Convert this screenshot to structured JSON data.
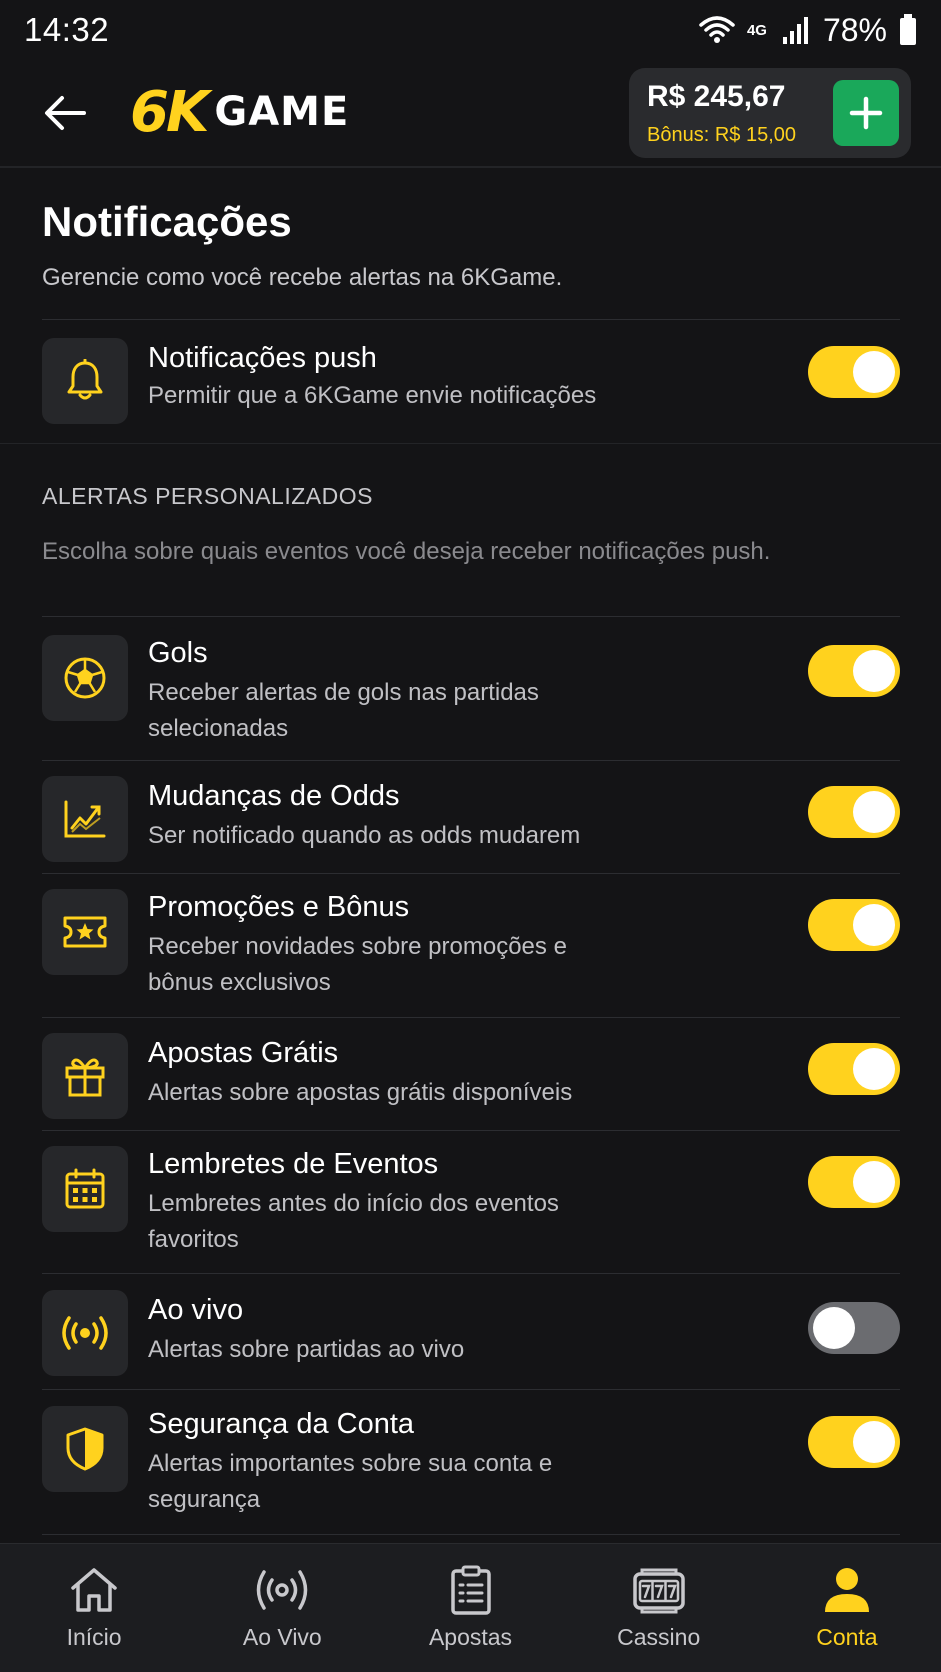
{
  "status_bar": {
    "time": "14:32",
    "network": "4G",
    "battery": "78%"
  },
  "header": {
    "logo_left": "6K",
    "logo_right": "GAME",
    "balance": "R$ 245,67",
    "bonus": "Bônus: R$ 15,00"
  },
  "page": {
    "title": "Notificações",
    "subtitle": "Gerencie como você recebe alertas na 6KGame."
  },
  "push": {
    "title": "Notificações push",
    "desc": "Permitir que a 6KGame envie notificações",
    "enabled": true,
    "icon": "bell-icon"
  },
  "section": {
    "heading": "ALERTAS PERSONALIZADOS",
    "desc": "Escolha sobre quais eventos você deseja receber notificações push."
  },
  "alerts": [
    {
      "title": "Gols",
      "desc": "Receber alertas de gols nas partidas selecionadas",
      "enabled": true,
      "icon": "soccer-ball-icon"
    },
    {
      "title": "Mudanças de Odds",
      "desc": "Ser notificado quando as odds mudarem",
      "enabled": true,
      "icon": "chart-trend-icon"
    },
    {
      "title": "Promoções e Bônus",
      "desc": "Receber novidades sobre promoções e bônus exclusivos",
      "enabled": true,
      "icon": "ticket-star-icon"
    },
    {
      "title": "Apostas Grátis",
      "desc": "Alertas sobre apostas grátis disponíveis",
      "enabled": true,
      "icon": "gift-icon"
    },
    {
      "title": "Lembretes de Eventos",
      "desc": "Lembretes antes do início dos eventos favoritos",
      "enabled": true,
      "icon": "calendar-icon"
    },
    {
      "title": "Ao vivo",
      "desc": "Alertas sobre partidas ao vivo",
      "enabled": false,
      "icon": "live-broadcast-icon"
    },
    {
      "title": "Segurança da Conta",
      "desc": "Alertas importantes sobre sua conta e segurança",
      "enabled": true,
      "icon": "shield-icon"
    }
  ],
  "nav": {
    "home": "Início",
    "live": "Ao Vivo",
    "bets": "Apostas",
    "casino": "Cassino",
    "account": "Conta",
    "active": "Conta"
  },
  "colors": {
    "accent": "#ffd21e",
    "deposit": "#1aa85a",
    "background": "#141416",
    "card": "#26272a"
  }
}
